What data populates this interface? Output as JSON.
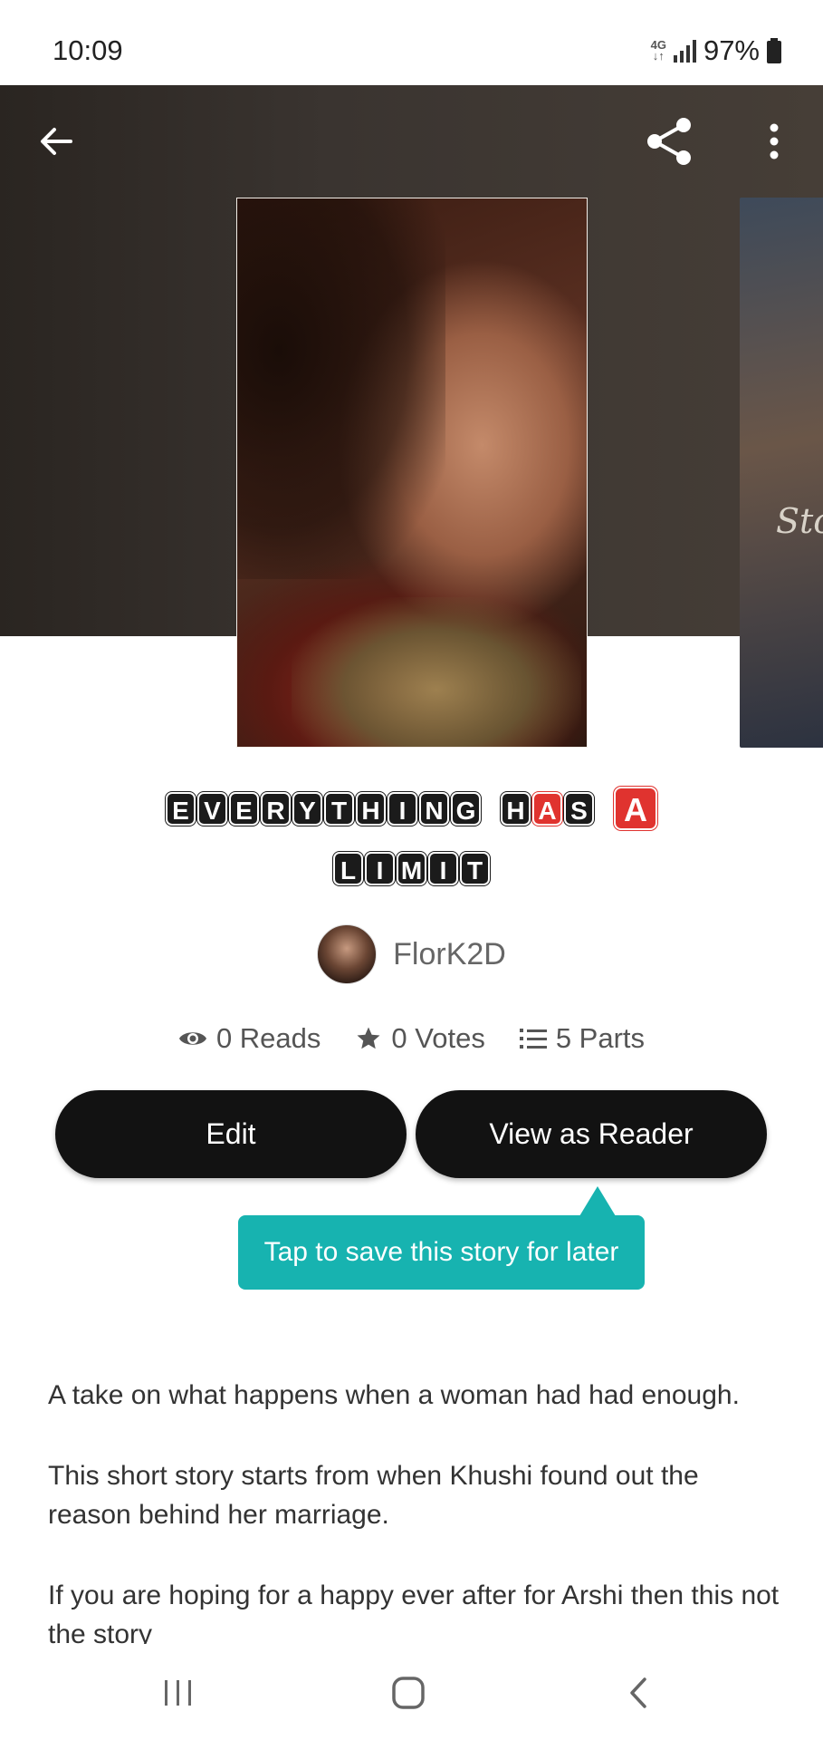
{
  "status_bar": {
    "time": "10:09",
    "network": "4G",
    "battery": "97%"
  },
  "header": {
    "icons": [
      "back-arrow-icon",
      "share-icon",
      "more-vert-icon"
    ]
  },
  "story": {
    "title_line1_word1": [
      "E",
      "V",
      "E",
      "R",
      "Y",
      "T",
      "H",
      "I",
      "N",
      "G"
    ],
    "title_line1_word2": [
      "H",
      "A",
      "S"
    ],
    "title_line1_word3": [
      "A"
    ],
    "title_line2": [
      "L",
      "I",
      "M",
      "I",
      "T"
    ],
    "next_cover_text": "Sto"
  },
  "author": {
    "name": "FlorK2D"
  },
  "stats": {
    "reads": "0 Reads",
    "votes": "0 Votes",
    "parts": "5 Parts"
  },
  "actions": {
    "edit_label": "Edit",
    "reader_label": "View as Reader"
  },
  "tooltip": {
    "text": "Tap to save this story for later"
  },
  "description": {
    "p1": "A take on what happens when a woman had had enough.",
    "p2": "This short story starts from when Khushi found out the reason behind her marriage.",
    "p3": "If you are hoping for a happy ever after for Arshi then this not the story"
  },
  "colors": {
    "accent_teal": "#17b3b0",
    "button_dark": "#121212",
    "title_red": "#e0332f"
  }
}
